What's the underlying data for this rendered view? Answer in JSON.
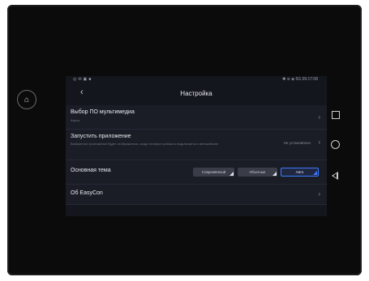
{
  "status": {
    "left_text": "◎ ✉ ▣ ■",
    "right_text": "✱ ≋ ◈ 5G 09:17:08"
  },
  "header": {
    "title": "Настройка"
  },
  "rows": {
    "multimedia": {
      "title": "Выбор ПО мультимедиа",
      "subtitle": "Карты"
    },
    "launch_app": {
      "title": "Запустить приложение",
      "subtitle": "Выбранное приложение будет отображаться, когда телефон успешно подключится к автомобилю",
      "value": "Не установлено"
    },
    "theme": {
      "title": "Основная тема",
      "options": [
        "Совремённый",
        "Обычные",
        "Авто"
      ],
      "selected": "Авто"
    },
    "about": {
      "title": "Об EasyCon"
    }
  },
  "icons": {
    "home": "home-icon",
    "back": "chevron-left-icon",
    "row_arrow": "chevron-right-icon",
    "nav_recents": "square-icon",
    "nav_home": "circle-icon",
    "nav_back": "triangle-back-icon"
  },
  "colors": {
    "accent": "#3c7cff",
    "background": "#14161d",
    "row": "#1a1d26"
  }
}
